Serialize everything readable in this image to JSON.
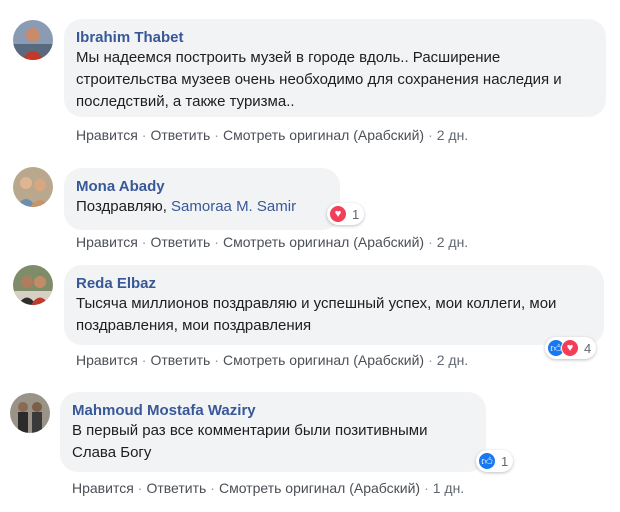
{
  "actions": {
    "like": "Нравится",
    "reply": "Ответить",
    "see_original": "Смотреть оригинал (Арабский)",
    "separator": "·"
  },
  "comments": [
    {
      "author": "Ibrahim Thabet",
      "text": "Мы надеемся построить музей в городе вдоль.. Расширение строительства музеев очень необходимо для сохранения наследия и последствий, а также туризма..",
      "time": "2 дн.",
      "reactions": null
    },
    {
      "author": "Mona Abady",
      "text_prefix": "Поздравляю,",
      "mention": "Samoraa M. Samir",
      "time": "2 дн.",
      "reactions": {
        "icons": [
          "heart-icon"
        ],
        "count": "1"
      }
    },
    {
      "author": "Reda Elbaz",
      "text": "Тысяча миллионов поздравляю и успешный успех, мои коллеги, мои поздравления, мои поздравления",
      "time": "2 дн.",
      "reactions": {
        "icons": [
          "like-icon",
          "heart-icon"
        ],
        "count": "4"
      }
    },
    {
      "author": "Mahmoud Mostafa Waziry",
      "text": "В первый раз все комментарии были позитивными Слава Богу",
      "time": "1 дн.",
      "reactions": {
        "icons": [
          "like-icon"
        ],
        "count": "1"
      }
    }
  ],
  "colors": {
    "author": "#385898",
    "bubble": "#f2f3f5",
    "like": "#1877f2",
    "love": "#f33e58"
  }
}
